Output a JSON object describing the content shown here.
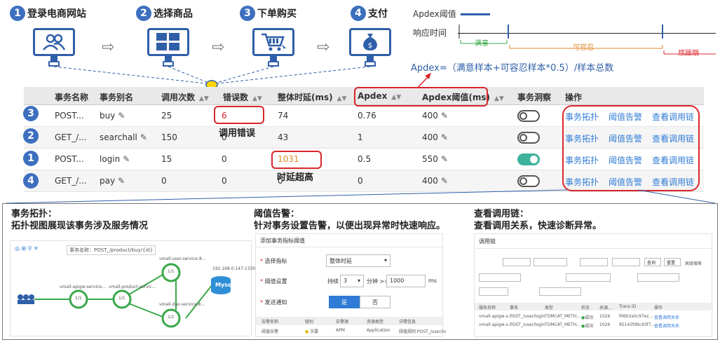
{
  "steps": [
    {
      "num": "1",
      "label": "登录电商网站",
      "icon": "users-icon"
    },
    {
      "num": "2",
      "label": "选择商品",
      "icon": "grid-icon"
    },
    {
      "num": "3",
      "label": "下单购买",
      "icon": "cart-icon"
    },
    {
      "num": "4",
      "label": "支付",
      "icon": "money-bag-icon"
    }
  ],
  "apdex": {
    "legend": "Apdex阈值",
    "response_time": "响应时间",
    "zone_satisfied": "满意",
    "zone_tolerating": "可容忍",
    "zone_frustrated": "烦躁期",
    "formula": "Apdex=（满意样本+可容忍样本*0.5）/样本总数"
  },
  "table": {
    "headers": [
      "事务名称",
      "事务别名",
      "调用次数",
      "错误数",
      "整体时延(ms)",
      "Apdex",
      "Apdex阈值(ms)",
      "事务洞察",
      "操作"
    ],
    "rows": [
      {
        "num": "3",
        "name": "POST...",
        "alias": "buy",
        "calls": "25",
        "errors": "6",
        "latency": "74",
        "apdex": "0.76",
        "threshold": "400",
        "insight": false,
        "ops": [
          "事务拓扑",
          "阈值告警",
          "查看调用链"
        ]
      },
      {
        "num": "2",
        "name": "GET_/...",
        "alias": "searchall",
        "calls": "150",
        "errors": "0",
        "latency": "43",
        "apdex": "1",
        "threshold": "400",
        "insight": false,
        "ops": [
          "事务拓扑",
          "阈值告警",
          "查看调用链"
        ]
      },
      {
        "num": "1",
        "name": "POST...",
        "alias": "login",
        "calls": "15",
        "errors": "0",
        "latency": "1031",
        "apdex": "0.5",
        "threshold": "550",
        "insight": true,
        "ops": [
          "事务拓扑",
          "阈值告警",
          "查看调用链"
        ]
      },
      {
        "num": "4",
        "name": "GET_/...",
        "alias": "pay",
        "calls": "0",
        "errors": "0",
        "latency": "0",
        "apdex": "0",
        "threshold": "400",
        "insight": false,
        "ops": [
          "事务拓扑",
          "阈值告警",
          "查看调用链"
        ]
      }
    ],
    "annot_error": "调用错误",
    "annot_latency": "时延超高"
  },
  "panels": {
    "topology": {
      "title": "事务拓扑：",
      "desc": "拓扑视图展现该事务涉及服务情况",
      "breadcrumb": "事务名称：POST_/product/buy/{id}",
      "nodes": [
        "vmall-apigw-service...",
        "vmall-product-servic...",
        "vmall-user-service:8...",
        "vmall-dao-service:8...",
        "192.168.0.147:13306"
      ],
      "node_calls": "1/1",
      "db_label": "Mysql"
    },
    "alarm": {
      "title": "阈值告警：",
      "desc": "针对事务设置告警，以便出现异常时快速响应。",
      "form_title": "添加事务指标阈值",
      "f1_label": "选择指标",
      "f1_value": "整体时延",
      "f2_label": "阈值设置",
      "f2_prefix": "持续",
      "f2_count": "3",
      "f2_mid": "分钟 >=",
      "f2_value": "1000",
      "f2_unit": "ms",
      "f3_label": "发送通知",
      "yes": "是",
      "no": "否",
      "cols": [
        "告警名称",
        "级别",
        "告警源",
        "资源类型",
        "详情信息"
      ],
      "row": [
        "阈值告警",
        "次要",
        "APM",
        "Application",
        "阈值规则 POST_/user/lo"
      ]
    },
    "trace": {
      "title": "查看调用链：",
      "desc": "查看调用关系，快速诊断异常。",
      "header": "调用链",
      "filter_btn": "查询",
      "reset_btn": "重置",
      "advanced": "高级搜索",
      "cols": [
        "服务名称",
        "事务",
        "类型",
        "状态",
        "总调...",
        "Trace ID",
        "操作"
      ],
      "rows": [
        [
          "vmall-apigw-s...",
          "POST_/user/login",
          "TOMCAT_METH...",
          "成功",
          "1026",
          "f06b3a5c97ec...",
          "查看调用关系"
        ],
        [
          "vmall-apigw-s...",
          "POST_/user/login",
          "TOMCAT_METH...",
          "成功",
          "1026",
          "85143fd9c93f7...",
          "查看调用关系"
        ]
      ]
    }
  },
  "colors": {
    "accent": "#2f5fa8",
    "alert": "#d9262c",
    "link": "#2f7bd6",
    "green": "#3aa84a",
    "orange": "#e08a2b"
  }
}
